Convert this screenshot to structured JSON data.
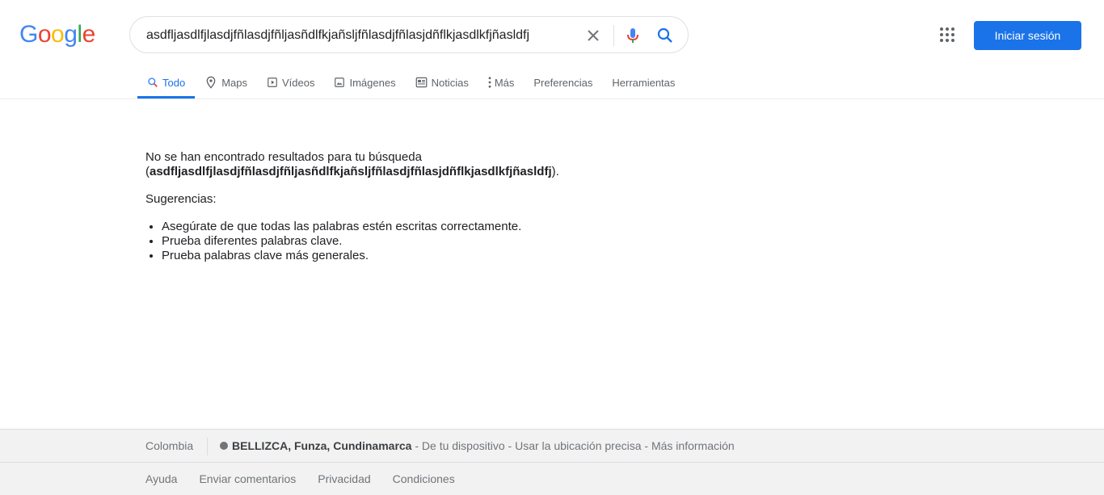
{
  "logo": {
    "letters": [
      "G",
      "o",
      "o",
      "g",
      "l",
      "e"
    ],
    "colors": [
      "#4285f4",
      "#ea4335",
      "#fbbc05",
      "#4285f4",
      "#34a853",
      "#ea4335"
    ]
  },
  "search": {
    "query": "asdfljasdlfjlasdjfñlasdjfñljasñdlfkjañsljfñlasdjfñlasjdñflkjasdlkfjñasldfj",
    "clear_icon": "close-icon",
    "mic_icon": "microphone-icon",
    "search_icon": "search-icon"
  },
  "header": {
    "apps_icon": "apps-grid-icon",
    "signin_label": "Iniciar sesión"
  },
  "tabs": [
    {
      "label": "Todo",
      "icon": "search-icon",
      "active": true
    },
    {
      "label": "Maps",
      "icon": "map-pin-icon"
    },
    {
      "label": "Vídeos",
      "icon": "video-icon"
    },
    {
      "label": "Imágenes",
      "icon": "image-icon"
    },
    {
      "label": "Noticias",
      "icon": "news-icon"
    },
    {
      "label": "Más",
      "icon": "more-vert-icon"
    },
    {
      "label": "Preferencias"
    },
    {
      "label": "Herramientas"
    }
  ],
  "results": {
    "no_results_prefix": "No se han encontrado resultados para tu búsqueda",
    "open_paren": "(",
    "query_bold": "asdfljasdlfjlasdjfñlasdjfñljasñdlfkjañsljfñlasdjfñlasjdñflkjasdlkfjñasldfj",
    "close_paren": ").",
    "suggestions_title": "Sugerencias:",
    "suggestions": [
      "Asegúrate de que todas las palabras estén escritas correctamente.",
      "Prueba diferentes palabras clave.",
      "Prueba palabras clave más generales."
    ]
  },
  "footer": {
    "country": "Colombia",
    "location_place": "BELLIZCA, Funza, Cundinamarca",
    "location_sep1": " - ",
    "location_source": "De tu dispositivo",
    "location_sep2": " - ",
    "location_precise": "Usar la ubicación precisa",
    "location_sep3": " - ",
    "location_more": "Más información",
    "links": [
      "Ayuda",
      "Enviar comentarios",
      "Privacidad",
      "Condiciones"
    ]
  },
  "colors": {
    "accent": "#1a73e8",
    "text": "#202124",
    "muted": "#70757a"
  }
}
